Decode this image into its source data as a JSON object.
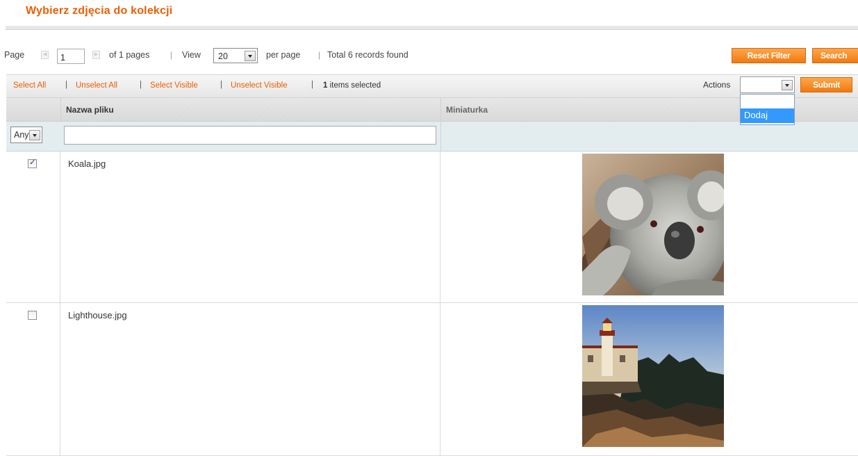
{
  "page_title": "Wybierz zdjęcia do kolekcji",
  "pager": {
    "page_label": "Page",
    "page_value": "1",
    "of_pages": "of 1 pages",
    "view_label": "View",
    "view_value": "20",
    "per_page_label": "per page",
    "total_records": "Total 6 records found",
    "separator": "|"
  },
  "buttons": {
    "reset_filter": "Reset Filter",
    "search": "Search",
    "submit": "Submit"
  },
  "massaction": {
    "select_all": "Select All",
    "unselect_all": "Unselect All",
    "select_visible": "Select Visible",
    "unselect_visible": "Unselect Visible",
    "selected_count": "1",
    "selected_suffix": " items selected",
    "separator": "|",
    "actions_label": "Actions",
    "actions_value": "",
    "actions_options": [
      "",
      "Dodaj"
    ]
  },
  "grid": {
    "columns": [
      "Nazwa pliku",
      "Miniaturka"
    ],
    "filter": {
      "any_value": "Any",
      "name_value": ""
    },
    "rows": [
      {
        "name": "Koala.jpg",
        "checked": true,
        "thumbnail": "koala-thumbnail"
      },
      {
        "name": "Lighthouse.jpg",
        "checked": false,
        "thumbnail": "lighthouse-thumbnail"
      }
    ]
  },
  "colors": {
    "accent": "#eb5e00",
    "button": "#f07a10",
    "filter_row": "#e3edf0",
    "highlight": "#3399ff"
  }
}
